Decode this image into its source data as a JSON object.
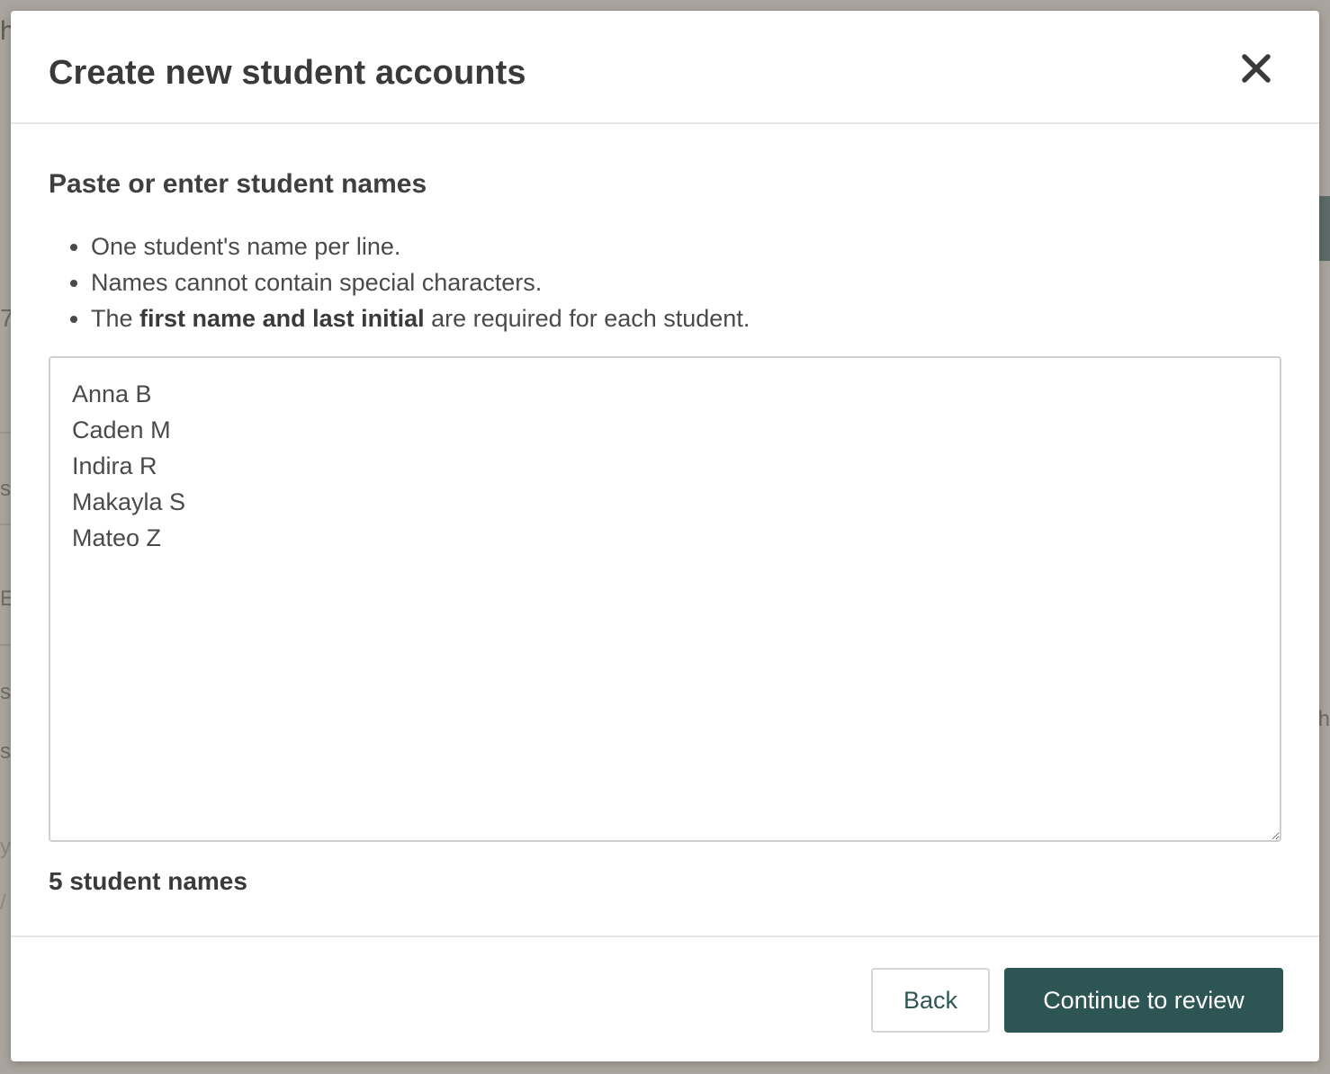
{
  "background": {
    "hints": [
      "h",
      "7",
      "s",
      "E",
      "s",
      "s",
      "y",
      "/",
      "th"
    ]
  },
  "modal": {
    "title": "Create new student accounts",
    "close_icon": "close-icon"
  },
  "body": {
    "heading": "Paste or enter student names",
    "rules": [
      {
        "text": "One student's name per line."
      },
      {
        "text": "Names cannot contain special characters."
      },
      {
        "prefix": "The ",
        "bold": "first name and last initial",
        "suffix": " are required for each student."
      }
    ],
    "names_value": "Anna B\nCaden M\nIndira R\nMakayla S\nMateo Z",
    "count_label": "5 student names"
  },
  "footer": {
    "back_label": "Back",
    "continue_label": "Continue to review"
  },
  "colors": {
    "accent": "#2c5554",
    "text": "#3a3a3a",
    "overlay": "#a9a59e"
  }
}
